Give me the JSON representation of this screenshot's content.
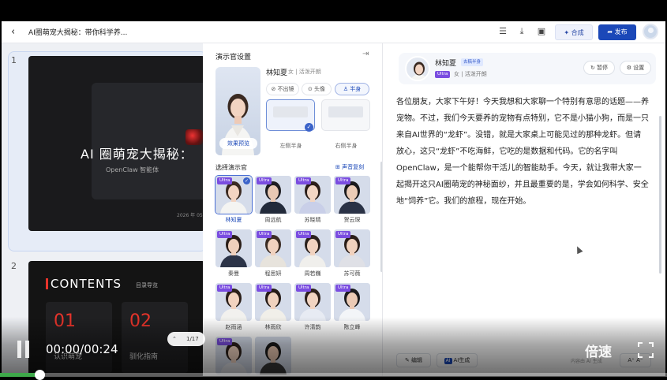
{
  "header": {
    "back_icon": "chevron-left-icon",
    "title": "AI圈萌宠大揭秘：带你科学养...",
    "merge_label": "合成",
    "publish_label": "发布"
  },
  "slides": [
    {
      "number": "1",
      "title": "AI 圈萌宠大揭秘：",
      "subtitle": "OpenClaw 智能体",
      "date": "2026 年 05"
    },
    {
      "number": "2",
      "heading": "CONTENTS",
      "heading_sub": "目录导览",
      "items": [
        {
          "num": "01",
          "label": "认识萌宠"
        },
        {
          "num": "02",
          "label": "驯化指南"
        }
      ]
    }
  ],
  "presenter_panel": {
    "title": "演示官设置",
    "current_name": "林知夏",
    "current_meta": "女 | 活泼开朗",
    "modes": [
      "不出镜",
      "头像",
      "半身"
    ],
    "active_mode": "半身",
    "preview_label": "效果预览",
    "positions": [
      "左侧半身",
      "右侧半身"
    ],
    "select_title": "选择演示官",
    "voice_copy_label": "声音复刻",
    "presenters": [
      {
        "name": "林知夏",
        "badge": "Ultra",
        "active": true
      },
      {
        "name": "周远航",
        "badge": "Ultra",
        "active": false
      },
      {
        "name": "苏晓晴",
        "badge": "Ultra",
        "active": false
      },
      {
        "name": "贺云琛",
        "badge": "Ultra",
        "active": false
      },
      {
        "name": "秦曼",
        "badge": "Ultra",
        "active": false
      },
      {
        "name": "程思妍",
        "badge": "Ultra",
        "active": false
      },
      {
        "name": "周若巍",
        "badge": "Ultra",
        "active": false
      },
      {
        "name": "苏可薇",
        "badge": "Ultra",
        "active": false
      },
      {
        "name": "赵雨涵",
        "badge": "Ultra",
        "active": false
      },
      {
        "name": "林雨欣",
        "badge": "Ultra",
        "active": false
      },
      {
        "name": "许清韵",
        "badge": "Ultra",
        "active": false
      },
      {
        "name": "陈立峰",
        "badge": "Ultra",
        "active": false
      },
      {
        "name": "",
        "badge": "Ultra",
        "active": false
      },
      {
        "name": "",
        "badge": "",
        "active": false
      }
    ]
  },
  "script_panel": {
    "name": "林知夏",
    "tag": "去稿半身",
    "badge": "Ultra",
    "meta": "女 | 活泼开朗",
    "pause_label": "暂停",
    "settings_label": "设置",
    "text": "各位朋友，大家下午好！今天我想和大家聊一个特别有意思的话题——养宠物。不过，我们今天要养的宠物有点特别，它不是小猫小狗，而是一只来自AI世界的“龙虾”。没错，就是大家桌上可能见过的那种龙虾。但请放心，这只“龙虾”不吃海鲜，它吃的是数据和代码。它的名字叫OpenClaw，是一个能帮你干活儿的智能助手。今天，就让我带大家一起揭开这只AI圈萌宠的神秘面纱，并且最重要的是，学会如何科学、安全地“饲养”它。我们的旅程，现在开始。",
    "edit_label": "编辑",
    "ai_badge": "AI",
    "ai_label": "AI生成",
    "ai_hint": "内容由 AI 生成",
    "font_label": "A⁺ A⁻"
  },
  "player": {
    "time": "00:00/00:24",
    "speed_label": "倍速",
    "progress": 0.06,
    "pager": "1/17"
  },
  "colors": {
    "accent": "#1b48b8",
    "ultra": "#7a4de0",
    "progress": "#3ea84a",
    "contents_red": "#e8342b"
  }
}
